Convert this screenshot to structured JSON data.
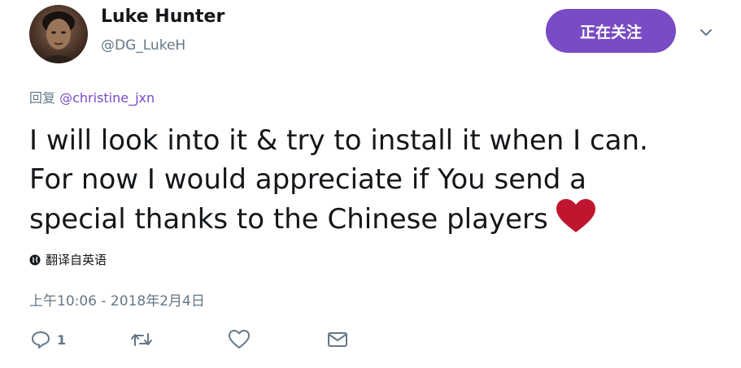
{
  "author": {
    "display_name": "Luke Hunter",
    "handle": "@DG_LukeH"
  },
  "follow_button_label": "正在关注",
  "reply": {
    "prefix": "回复",
    "mention": "@christine_jxn"
  },
  "tweet": {
    "lines": [
      "I will look into it & try to install it when I can.",
      "For now I would appreciate if You send a",
      "special thanks to the Chinese players"
    ],
    "emoji": "red-heart"
  },
  "translate_label": "翻译自英语",
  "timestamp": "上午10:06 - 2018年2月4日",
  "actions": {
    "reply_count": "1"
  },
  "colors": {
    "accent": "#794bc4",
    "secondary_text": "#657786",
    "heart": "#c0152f"
  },
  "icons": {
    "caret": "chevron-down-icon",
    "globe": "globe-icon",
    "reply": "reply-icon",
    "retweet": "retweet-icon",
    "like": "like-icon",
    "message": "direct-message-icon"
  }
}
